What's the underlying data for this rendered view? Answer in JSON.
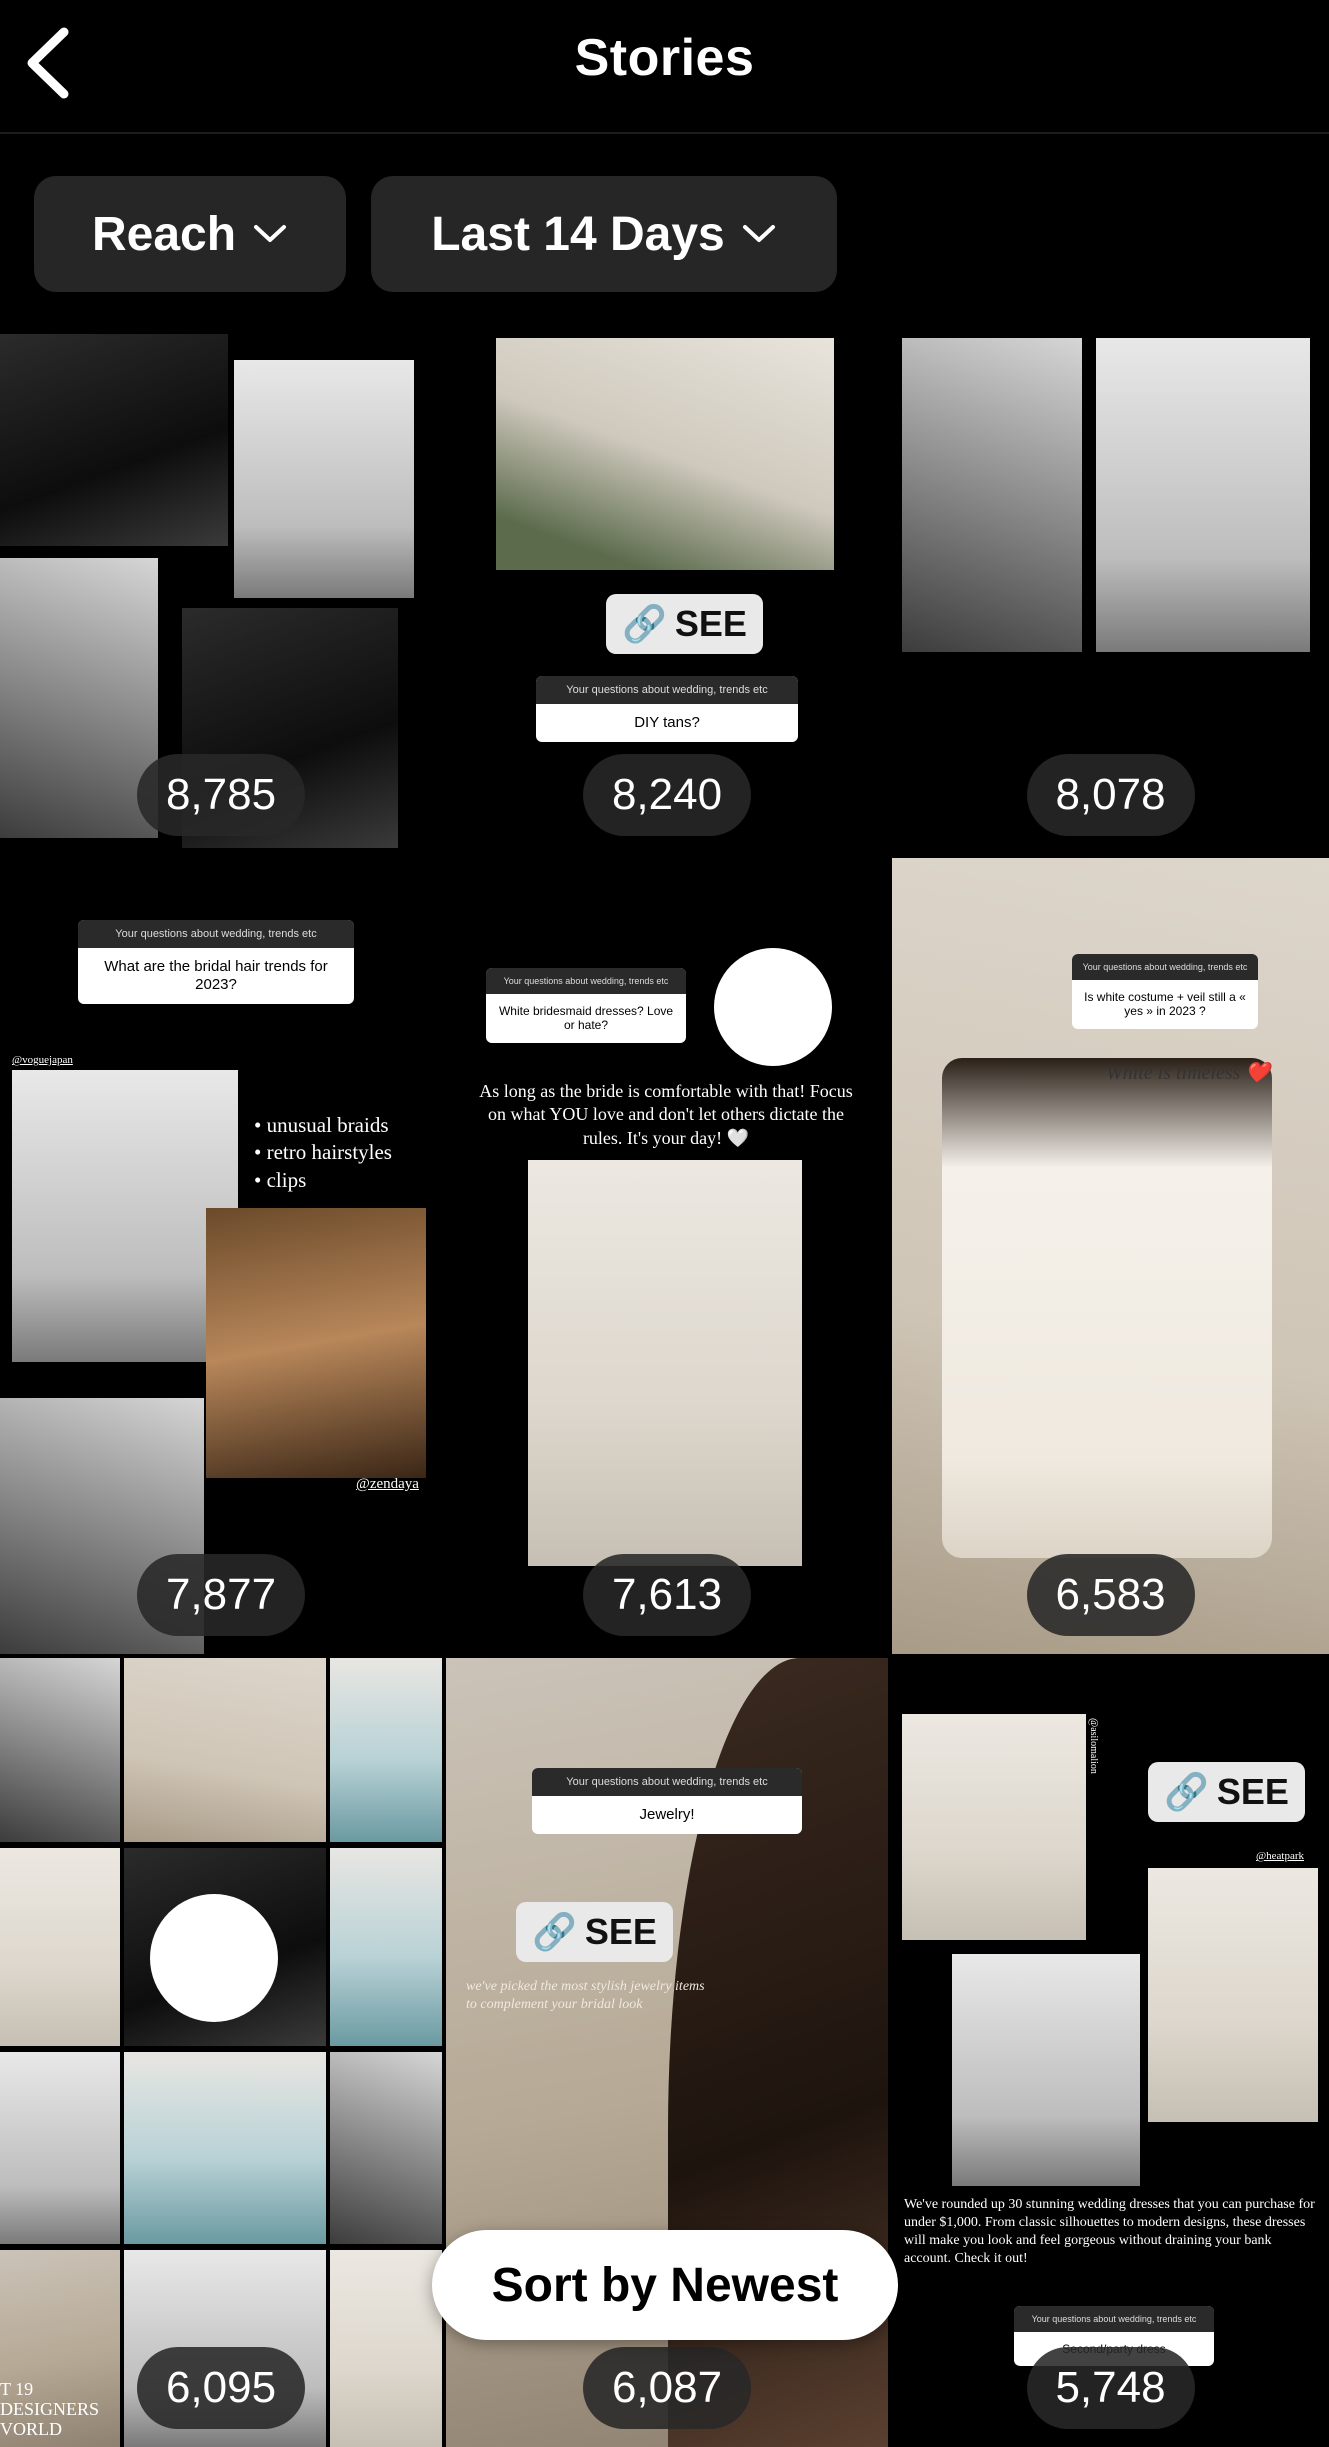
{
  "header": {
    "title": "Stories",
    "back_icon": "chevron-left-icon"
  },
  "filters": {
    "metric": {
      "label": "Reach",
      "icon": "chevron-down-icon"
    },
    "range": {
      "label": "Last 14 Days",
      "icon": "chevron-down-icon"
    }
  },
  "stories": [
    {
      "reach": "8,785"
    },
    {
      "reach": "8,240",
      "see_label": "SEE",
      "question_header": "Your questions about wedding, trends etc",
      "question": "DIY tans?"
    },
    {
      "reach": "8,078"
    },
    {
      "reach": "7,877",
      "question_header": "Your questions about wedding, trends etc",
      "question": "What are the bridal hair trends for 2023?",
      "credit_top": "@voguejapan",
      "bullets": [
        "• unusual braids",
        "• retro hairstyles",
        "• clips"
      ],
      "credit_bottom": "@zendaya"
    },
    {
      "reach": "7,613",
      "question_header": "Your questions about wedding, trends etc",
      "question": "White bridesmaid dresses? Love or hate?",
      "caption": "As long as the bride is comfortable with that! Focus on what YOU love and don't let others dictate the rules. It's your day! 🤍",
      "emoji": "😍"
    },
    {
      "reach": "6,583",
      "question_header": "Your questions about wedding, trends etc",
      "question": "Is white costume + veil still a « yes » in 2023 ?",
      "caption": "White is timeless ❤️"
    },
    {
      "reach": "6,095",
      "emoji": "😍",
      "overlay_text": "T 19 DESIGNERS VORLD"
    },
    {
      "reach": "6,087",
      "question_header": "Your questions about wedding, trends etc",
      "question": "Jewelry!",
      "see_label": "SEE",
      "caption": "we've picked the most stylish jewelry items to complement your bridal look"
    },
    {
      "reach": "5,748",
      "see_label": "SEE",
      "credit_top": "@asilomalion",
      "credit_side": "@heatpark",
      "caption": "We've rounded up 30 stunning wedding dresses that you can purchase for under $1,000. From classic silhouettes to modern designs, these dresses will make you look and feel gorgeous without draining your bank account. Check it out!",
      "question_header": "Your questions about wedding, trends etc",
      "question": "Second/party dress"
    }
  ],
  "sort": {
    "label": "Sort by Newest"
  }
}
